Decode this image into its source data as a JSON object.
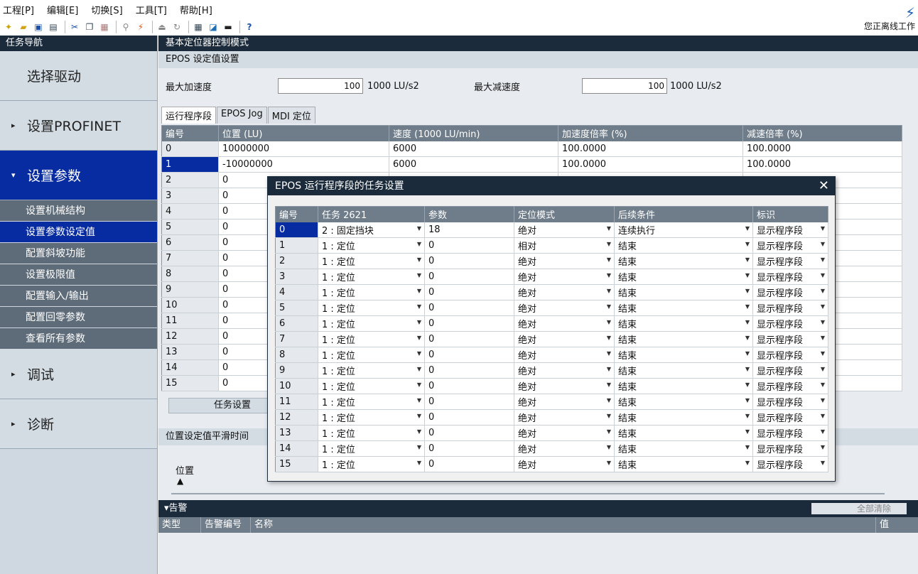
{
  "menu": [
    "工程[P]",
    "编辑[E]",
    "切换[S]",
    "工具[T]",
    "帮助[H]"
  ],
  "toolbar": {
    "icons": [
      "new-icon",
      "open-icon",
      "save-icon",
      "print-icon",
      "cut-icon",
      "copy-icon",
      "paste-icon",
      "connect-icon",
      "disconnect-icon",
      "upload-icon",
      "refresh-icon",
      "table-icon",
      "trend-icon",
      "device-icon",
      "help-icon"
    ],
    "status": "您正离线工作"
  },
  "nav": {
    "header": "任务导航",
    "items": [
      {
        "label": "选择驱动",
        "arrow": ""
      },
      {
        "label": "设置PROFINET",
        "arrow": "▸"
      },
      {
        "label": "设置参数",
        "arrow": "▾"
      }
    ],
    "subitems": [
      "设置机械结构",
      "设置参数设定值",
      "配置斜坡功能",
      "设置极限值",
      "配置输入/输出",
      "配置回零参数",
      "查看所有参数"
    ],
    "bottom": [
      {
        "label": "调试",
        "arrow": "▸"
      },
      {
        "label": "诊断",
        "arrow": "▸"
      }
    ]
  },
  "main": {
    "header": "基本定位器控制模式",
    "section": "EPOS 设定值设置",
    "max_acc_label": "最大加速度",
    "max_acc_value": "100",
    "max_acc_unit": "1000 LU/s2",
    "max_dec_label": "最大减速度",
    "max_dec_value": "100",
    "max_dec_unit": "1000 LU/s2",
    "tabs": [
      "运行程序段",
      "EPOS Jog",
      "MDI 定位"
    ],
    "columns": [
      "编号",
      "位置 (LU)",
      "速度 (1000 LU/min)",
      "加速度倍率 (%)",
      "减速倍率 (%)"
    ],
    "rows": [
      [
        "0",
        "10000000",
        "6000",
        "100.0000",
        "100.0000"
      ],
      [
        "1",
        "-10000000",
        "6000",
        "100.0000",
        "100.0000"
      ],
      [
        "2",
        "0",
        "",
        "",
        ""
      ],
      [
        "3",
        "0",
        "",
        "",
        ""
      ],
      [
        "4",
        "0",
        "",
        "",
        ""
      ],
      [
        "5",
        "0",
        "",
        "",
        ""
      ],
      [
        "6",
        "0",
        "",
        "",
        ""
      ],
      [
        "7",
        "0",
        "",
        "",
        ""
      ],
      [
        "8",
        "0",
        "",
        "",
        ""
      ],
      [
        "9",
        "0",
        "",
        "",
        ""
      ],
      [
        "10",
        "0",
        "",
        "",
        ""
      ],
      [
        "11",
        "0",
        "",
        "",
        ""
      ],
      [
        "12",
        "0",
        "",
        "",
        ""
      ],
      [
        "13",
        "0",
        "",
        "",
        ""
      ],
      [
        "14",
        "0",
        "",
        "",
        ""
      ],
      [
        "15",
        "0",
        "",
        "",
        ""
      ]
    ],
    "task_button": "任务设置",
    "smooth_section": "位置设定值平滑时间",
    "pos_label": "位置"
  },
  "alarm": {
    "title": "▾告警",
    "clear_all": "全部清除",
    "columns": [
      "类型",
      "告警编号",
      "名称",
      "值"
    ]
  },
  "dialog": {
    "title": "EPOS 运行程序段的任务设置",
    "columns": [
      "编号",
      "任务 2621",
      "参数",
      "定位模式",
      "后续条件",
      "标识"
    ],
    "rows": [
      [
        "0",
        "2 : 固定挡块",
        "18",
        "绝对",
        "连续执行",
        "显示程序段"
      ],
      [
        "1",
        "1 : 定位",
        "0",
        "相对",
        "结束",
        "显示程序段"
      ],
      [
        "2",
        "1 : 定位",
        "0",
        "绝对",
        "结束",
        "显示程序段"
      ],
      [
        "3",
        "1 : 定位",
        "0",
        "绝对",
        "结束",
        "显示程序段"
      ],
      [
        "4",
        "1 : 定位",
        "0",
        "绝对",
        "结束",
        "显示程序段"
      ],
      [
        "5",
        "1 : 定位",
        "0",
        "绝对",
        "结束",
        "显示程序段"
      ],
      [
        "6",
        "1 : 定位",
        "0",
        "绝对",
        "结束",
        "显示程序段"
      ],
      [
        "7",
        "1 : 定位",
        "0",
        "绝对",
        "结束",
        "显示程序段"
      ],
      [
        "8",
        "1 : 定位",
        "0",
        "绝对",
        "结束",
        "显示程序段"
      ],
      [
        "9",
        "1 : 定位",
        "0",
        "绝对",
        "结束",
        "显示程序段"
      ],
      [
        "10",
        "1 : 定位",
        "0",
        "绝对",
        "结束",
        "显示程序段"
      ],
      [
        "11",
        "1 : 定位",
        "0",
        "绝对",
        "结束",
        "显示程序段"
      ],
      [
        "12",
        "1 : 定位",
        "0",
        "绝对",
        "结束",
        "显示程序段"
      ],
      [
        "13",
        "1 : 定位",
        "0",
        "绝对",
        "结束",
        "显示程序段"
      ],
      [
        "14",
        "1 : 定位",
        "0",
        "绝对",
        "结束",
        "显示程序段"
      ],
      [
        "15",
        "1 : 定位",
        "0",
        "绝对",
        "结束",
        "显示程序段"
      ]
    ]
  }
}
